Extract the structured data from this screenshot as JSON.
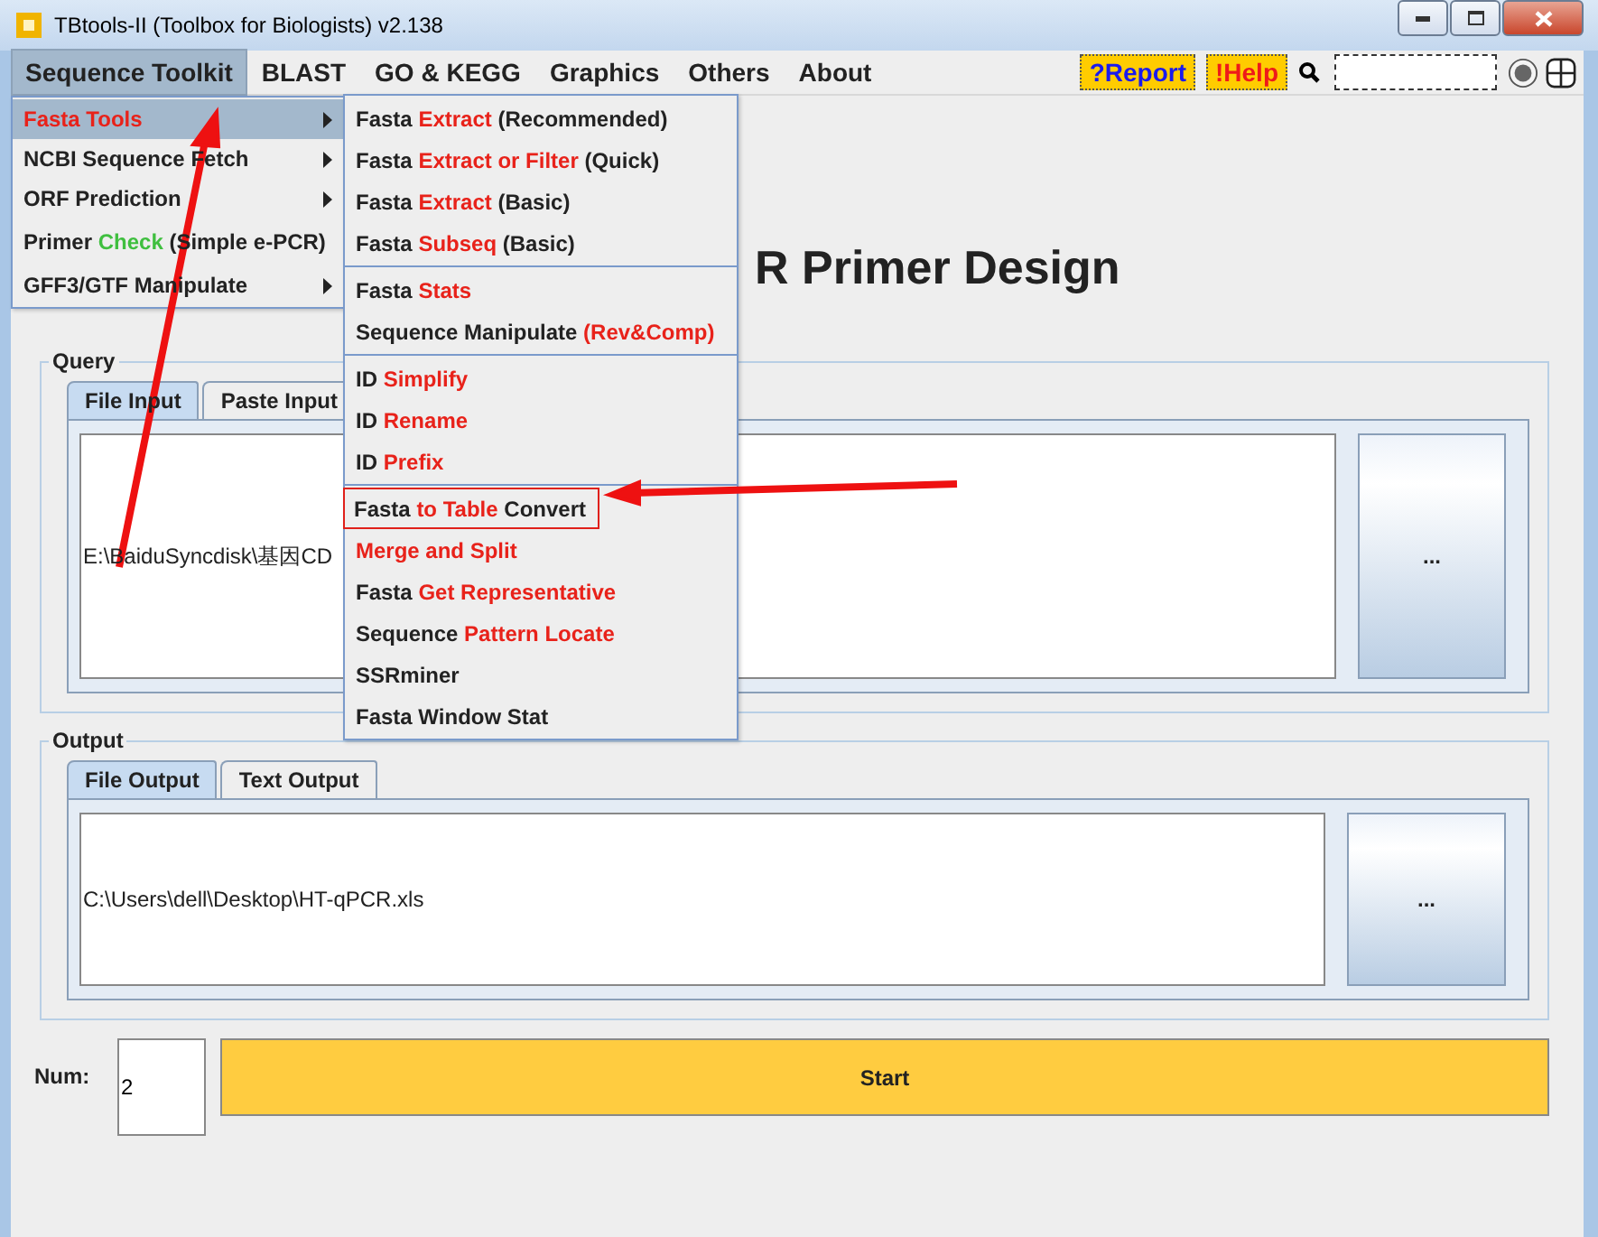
{
  "window": {
    "title": "TBtools-II (Toolbox for Biologists) v2.138"
  },
  "menubar": {
    "items": [
      {
        "label": "Sequence Toolkit",
        "selected": true
      },
      {
        "label": "BLAST",
        "selected": false
      },
      {
        "label": "GO & KEGG",
        "selected": false
      },
      {
        "label": "Graphics",
        "selected": false
      },
      {
        "label": "Others",
        "selected": false
      },
      {
        "label": "About",
        "selected": false
      }
    ],
    "report": "?Report",
    "help": "!Help"
  },
  "menu": {
    "items": [
      {
        "parts": [
          {
            "text": "Fasta Tools",
            "color": "#e8221a"
          }
        ],
        "submenu": true,
        "selected": true
      },
      {
        "parts": [
          {
            "text": "NCBI Sequence Fetch",
            "color": "#222222"
          }
        ],
        "submenu": true,
        "selected": false
      },
      {
        "parts": [
          {
            "text": "ORF Prediction",
            "color": "#222222"
          }
        ],
        "submenu": true,
        "selected": false
      },
      {
        "parts": [
          {
            "text": "Primer ",
            "color": "#222222"
          },
          {
            "text": "Check",
            "color": "#3fbf3f"
          },
          {
            "text": " (Simple e-PCR)",
            "color": "#222222"
          }
        ],
        "submenu": false,
        "selected": false
      },
      {
        "parts": [
          {
            "text": "GFF3/GTF Manipulate",
            "color": "#222222"
          }
        ],
        "submenu": true,
        "selected": false
      }
    ]
  },
  "submenu": {
    "groups": [
      {
        "items": [
          {
            "parts": [
              {
                "text": "Fasta ",
                "color": "#222222"
              },
              {
                "text": "Extract",
                "color": "#e8221a"
              },
              {
                "text": " (Recommended)",
                "color": "#222222"
              }
            ],
            "highlighted": false
          },
          {
            "parts": [
              {
                "text": "Fasta ",
                "color": "#222222"
              },
              {
                "text": "Extract or Filter",
                "color": "#e8221a"
              },
              {
                "text": " (Quick)",
                "color": "#222222"
              }
            ],
            "highlighted": false
          },
          {
            "parts": [
              {
                "text": "Fasta ",
                "color": "#222222"
              },
              {
                "text": "Extract",
                "color": "#e8221a"
              },
              {
                "text": " (Basic)",
                "color": "#222222"
              }
            ],
            "highlighted": false
          },
          {
            "parts": [
              {
                "text": "Fasta ",
                "color": "#222222"
              },
              {
                "text": "Subseq",
                "color": "#e8221a"
              },
              {
                "text": " (Basic)",
                "color": "#222222"
              }
            ],
            "highlighted": false
          }
        ]
      },
      {
        "items": [
          {
            "parts": [
              {
                "text": "Fasta ",
                "color": "#222222"
              },
              {
                "text": "Stats",
                "color": "#e8221a"
              }
            ],
            "highlighted": false
          },
          {
            "parts": [
              {
                "text": "Sequence Manipulate ",
                "color": "#222222"
              },
              {
                "text": "(Rev&Comp)",
                "color": "#e8221a"
              }
            ],
            "highlighted": false
          }
        ]
      },
      {
        "items": [
          {
            "parts": [
              {
                "text": "ID ",
                "color": "#222222"
              },
              {
                "text": "Simplify",
                "color": "#e8221a"
              }
            ],
            "highlighted": false
          },
          {
            "parts": [
              {
                "text": "ID ",
                "color": "#222222"
              },
              {
                "text": "Rename",
                "color": "#e8221a"
              }
            ],
            "highlighted": false
          },
          {
            "parts": [
              {
                "text": "ID ",
                "color": "#222222"
              },
              {
                "text": "Prefix",
                "color": "#e8221a"
              }
            ],
            "highlighted": false
          }
        ]
      },
      {
        "items": [
          {
            "parts": [
              {
                "text": "Fasta ",
                "color": "#222222"
              },
              {
                "text": "to Table",
                "color": "#e8221a"
              },
              {
                "text": " Convert",
                "color": "#222222"
              }
            ],
            "highlighted": true
          },
          {
            "parts": [
              {
                "text": "Merge and Split",
                "color": "#e8221a"
              }
            ],
            "highlighted": false
          },
          {
            "parts": [
              {
                "text": "Fasta ",
                "color": "#222222"
              },
              {
                "text": "Get Representative",
                "color": "#e8221a"
              }
            ],
            "highlighted": false
          },
          {
            "parts": [
              {
                "text": "Sequence ",
                "color": "#222222"
              },
              {
                "text": "Pattern Locate",
                "color": "#e8221a"
              }
            ],
            "highlighted": false
          },
          {
            "parts": [
              {
                "text": "SSRminer",
                "color": "#222222"
              }
            ],
            "highlighted": false
          },
          {
            "parts": [
              {
                "text": "Fasta Window Stat",
                "color": "#222222"
              }
            ],
            "highlighted": false
          }
        ]
      }
    ]
  },
  "heading": "R Primer Design",
  "query": {
    "title": "Query",
    "tabs": [
      {
        "label": "File Input",
        "selected": true
      },
      {
        "label": "Paste Input",
        "selected": false
      }
    ],
    "path": "E:\\BaiduSyncdisk\\基因CD",
    "browse": "..."
  },
  "output": {
    "title": "Output",
    "tabs": [
      {
        "label": "File Output",
        "selected": true
      },
      {
        "label": "Text Output",
        "selected": false
      }
    ],
    "path": "C:\\Users\\dell\\Desktop\\HT-qPCR.xls",
    "browse": "..."
  },
  "num": {
    "label": "Num:",
    "value": "2"
  },
  "start": "Start"
}
